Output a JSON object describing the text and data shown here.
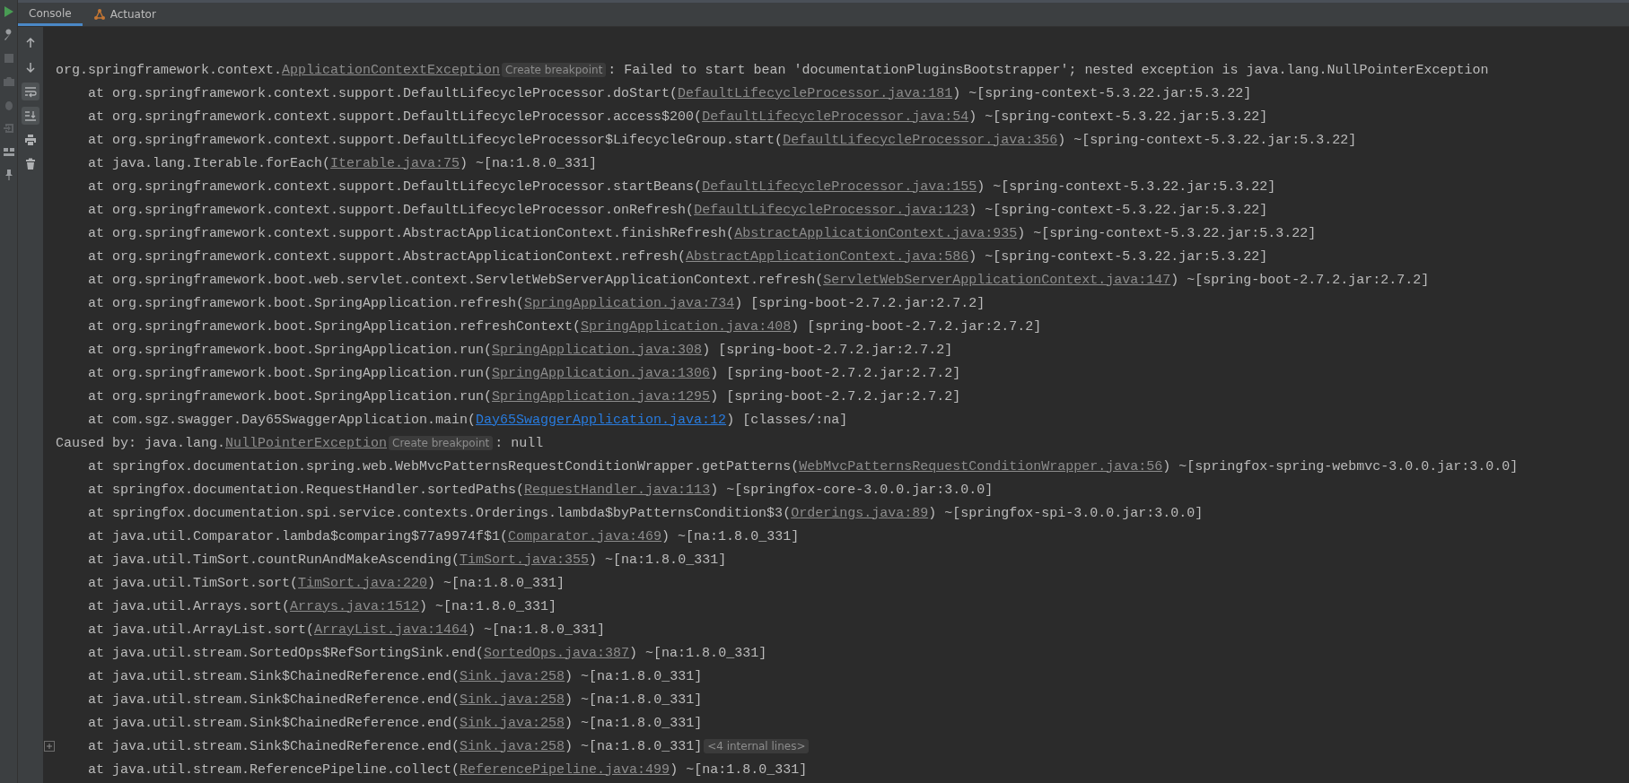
{
  "tabs": [
    {
      "label": "Console",
      "selected": true,
      "icon": false
    },
    {
      "label": "Actuator",
      "selected": false,
      "icon": true
    }
  ],
  "lines": [
    {
      "indent": false,
      "fold": false,
      "parts": [
        {
          "kind": "plain",
          "text": "org.springframework.context."
        },
        {
          "kind": "link",
          "text": "ApplicationContextException"
        },
        {
          "kind": "badge",
          "text": "Create breakpoint"
        },
        {
          "kind": "plain",
          "text": ": Failed to start bean 'documentationPluginsBootstrapper'; nested exception is java.lang.NullPointerException"
        }
      ]
    },
    {
      "indent": true,
      "fold": false,
      "parts": [
        {
          "kind": "plain",
          "text": "at org.springframework.context.support.DefaultLifecycleProcessor.doStart("
        },
        {
          "kind": "link",
          "text": "DefaultLifecycleProcessor.java:181"
        },
        {
          "kind": "plain",
          "text": ") ~[spring-context-5.3.22.jar:5.3.22]"
        }
      ]
    },
    {
      "indent": true,
      "fold": false,
      "parts": [
        {
          "kind": "plain",
          "text": "at org.springframework.context.support.DefaultLifecycleProcessor.access$200("
        },
        {
          "kind": "link",
          "text": "DefaultLifecycleProcessor.java:54"
        },
        {
          "kind": "plain",
          "text": ") ~[spring-context-5.3.22.jar:5.3.22]"
        }
      ]
    },
    {
      "indent": true,
      "fold": false,
      "parts": [
        {
          "kind": "plain",
          "text": "at org.springframework.context.support.DefaultLifecycleProcessor$LifecycleGroup.start("
        },
        {
          "kind": "link",
          "text": "DefaultLifecycleProcessor.java:356"
        },
        {
          "kind": "plain",
          "text": ") ~[spring-context-5.3.22.jar:5.3.22]"
        }
      ]
    },
    {
      "indent": true,
      "fold": false,
      "parts": [
        {
          "kind": "plain",
          "text": "at java.lang.Iterable.forEach("
        },
        {
          "kind": "link",
          "text": "Iterable.java:75"
        },
        {
          "kind": "plain",
          "text": ") ~[na:1.8.0_331]"
        }
      ]
    },
    {
      "indent": true,
      "fold": false,
      "parts": [
        {
          "kind": "plain",
          "text": "at org.springframework.context.support.DefaultLifecycleProcessor.startBeans("
        },
        {
          "kind": "link",
          "text": "DefaultLifecycleProcessor.java:155"
        },
        {
          "kind": "plain",
          "text": ") ~[spring-context-5.3.22.jar:5.3.22]"
        }
      ]
    },
    {
      "indent": true,
      "fold": false,
      "parts": [
        {
          "kind": "plain",
          "text": "at org.springframework.context.support.DefaultLifecycleProcessor.onRefresh("
        },
        {
          "kind": "link",
          "text": "DefaultLifecycleProcessor.java:123"
        },
        {
          "kind": "plain",
          "text": ") ~[spring-context-5.3.22.jar:5.3.22]"
        }
      ]
    },
    {
      "indent": true,
      "fold": false,
      "parts": [
        {
          "kind": "plain",
          "text": "at org.springframework.context.support.AbstractApplicationContext.finishRefresh("
        },
        {
          "kind": "link",
          "text": "AbstractApplicationContext.java:935"
        },
        {
          "kind": "plain",
          "text": ") ~[spring-context-5.3.22.jar:5.3.22]"
        }
      ]
    },
    {
      "indent": true,
      "fold": false,
      "parts": [
        {
          "kind": "plain",
          "text": "at org.springframework.context.support.AbstractApplicationContext.refresh("
        },
        {
          "kind": "link",
          "text": "AbstractApplicationContext.java:586"
        },
        {
          "kind": "plain",
          "text": ") ~[spring-context-5.3.22.jar:5.3.22]"
        }
      ]
    },
    {
      "indent": true,
      "fold": false,
      "parts": [
        {
          "kind": "plain",
          "text": "at org.springframework.boot.web.servlet.context.ServletWebServerApplicationContext.refresh("
        },
        {
          "kind": "link",
          "text": "ServletWebServerApplicationContext.java:147"
        },
        {
          "kind": "plain",
          "text": ") ~[spring-boot-2.7.2.jar:2.7.2]"
        }
      ]
    },
    {
      "indent": true,
      "fold": false,
      "parts": [
        {
          "kind": "plain",
          "text": "at org.springframework.boot.SpringApplication.refresh("
        },
        {
          "kind": "link",
          "text": "SpringApplication.java:734"
        },
        {
          "kind": "plain",
          "text": ") [spring-boot-2.7.2.jar:2.7.2]"
        }
      ]
    },
    {
      "indent": true,
      "fold": false,
      "parts": [
        {
          "kind": "plain",
          "text": "at org.springframework.boot.SpringApplication.refreshContext("
        },
        {
          "kind": "link",
          "text": "SpringApplication.java:408"
        },
        {
          "kind": "plain",
          "text": ") [spring-boot-2.7.2.jar:2.7.2]"
        }
      ]
    },
    {
      "indent": true,
      "fold": false,
      "parts": [
        {
          "kind": "plain",
          "text": "at org.springframework.boot.SpringApplication.run("
        },
        {
          "kind": "link",
          "text": "SpringApplication.java:308"
        },
        {
          "kind": "plain",
          "text": ") [spring-boot-2.7.2.jar:2.7.2]"
        }
      ]
    },
    {
      "indent": true,
      "fold": false,
      "parts": [
        {
          "kind": "plain",
          "text": "at org.springframework.boot.SpringApplication.run("
        },
        {
          "kind": "link",
          "text": "SpringApplication.java:1306"
        },
        {
          "kind": "plain",
          "text": ") [spring-boot-2.7.2.jar:2.7.2]"
        }
      ]
    },
    {
      "indent": true,
      "fold": false,
      "parts": [
        {
          "kind": "plain",
          "text": "at org.springframework.boot.SpringApplication.run("
        },
        {
          "kind": "link",
          "text": "SpringApplication.java:1295"
        },
        {
          "kind": "plain",
          "text": ") [spring-boot-2.7.2.jar:2.7.2]"
        }
      ]
    },
    {
      "indent": true,
      "fold": false,
      "parts": [
        {
          "kind": "plain",
          "text": "at com.sgz.swagger.Day65SwaggerApplication.main("
        },
        {
          "kind": "source_link",
          "text": "Day65SwaggerApplication.java:12"
        },
        {
          "kind": "plain",
          "text": ") [classes/:na]"
        }
      ]
    },
    {
      "indent": false,
      "fold": false,
      "parts": [
        {
          "kind": "plain",
          "text": "Caused by: java.lang."
        },
        {
          "kind": "link",
          "text": "NullPointerException"
        },
        {
          "kind": "badge",
          "text": "Create breakpoint"
        },
        {
          "kind": "plain",
          "text": ": null"
        }
      ]
    },
    {
      "indent": true,
      "fold": false,
      "parts": [
        {
          "kind": "plain",
          "text": "at springfox.documentation.spring.web.WebMvcPatternsRequestConditionWrapper.getPatterns("
        },
        {
          "kind": "link",
          "text": "WebMvcPatternsRequestConditionWrapper.java:56"
        },
        {
          "kind": "plain",
          "text": ") ~[springfox-spring-webmvc-3.0.0.jar:3.0.0]"
        }
      ]
    },
    {
      "indent": true,
      "fold": false,
      "parts": [
        {
          "kind": "plain",
          "text": "at springfox.documentation.RequestHandler.sortedPaths("
        },
        {
          "kind": "link",
          "text": "RequestHandler.java:113"
        },
        {
          "kind": "plain",
          "text": ") ~[springfox-core-3.0.0.jar:3.0.0]"
        }
      ]
    },
    {
      "indent": true,
      "fold": false,
      "parts": [
        {
          "kind": "plain",
          "text": "at springfox.documentation.spi.service.contexts.Orderings.lambda$byPatternsCondition$3("
        },
        {
          "kind": "link",
          "text": "Orderings.java:89"
        },
        {
          "kind": "plain",
          "text": ") ~[springfox-spi-3.0.0.jar:3.0.0]"
        }
      ]
    },
    {
      "indent": true,
      "fold": false,
      "parts": [
        {
          "kind": "plain",
          "text": "at java.util.Comparator.lambda$comparing$77a9974f$1("
        },
        {
          "kind": "link",
          "text": "Comparator.java:469"
        },
        {
          "kind": "plain",
          "text": ") ~[na:1.8.0_331]"
        }
      ]
    },
    {
      "indent": true,
      "fold": false,
      "parts": [
        {
          "kind": "plain",
          "text": "at java.util.TimSort.countRunAndMakeAscending("
        },
        {
          "kind": "link",
          "text": "TimSort.java:355"
        },
        {
          "kind": "plain",
          "text": ") ~[na:1.8.0_331]"
        }
      ]
    },
    {
      "indent": true,
      "fold": false,
      "parts": [
        {
          "kind": "plain",
          "text": "at java.util.TimSort.sort("
        },
        {
          "kind": "link",
          "text": "TimSort.java:220"
        },
        {
          "kind": "plain",
          "text": ") ~[na:1.8.0_331]"
        }
      ]
    },
    {
      "indent": true,
      "fold": false,
      "parts": [
        {
          "kind": "plain",
          "text": "at java.util.Arrays.sort("
        },
        {
          "kind": "link",
          "text": "Arrays.java:1512"
        },
        {
          "kind": "plain",
          "text": ") ~[na:1.8.0_331]"
        }
      ]
    },
    {
      "indent": true,
      "fold": false,
      "parts": [
        {
          "kind": "plain",
          "text": "at java.util.ArrayList.sort("
        },
        {
          "kind": "link",
          "text": "ArrayList.java:1464"
        },
        {
          "kind": "plain",
          "text": ") ~[na:1.8.0_331]"
        }
      ]
    },
    {
      "indent": true,
      "fold": false,
      "parts": [
        {
          "kind": "plain",
          "text": "at java.util.stream.SortedOps$RefSortingSink.end("
        },
        {
          "kind": "link",
          "text": "SortedOps.java:387"
        },
        {
          "kind": "plain",
          "text": ") ~[na:1.8.0_331]"
        }
      ]
    },
    {
      "indent": true,
      "fold": false,
      "parts": [
        {
          "kind": "plain",
          "text": "at java.util.stream.Sink$ChainedReference.end("
        },
        {
          "kind": "link",
          "text": "Sink.java:258"
        },
        {
          "kind": "plain",
          "text": ") ~[na:1.8.0_331]"
        }
      ]
    },
    {
      "indent": true,
      "fold": false,
      "parts": [
        {
          "kind": "plain",
          "text": "at java.util.stream.Sink$ChainedReference.end("
        },
        {
          "kind": "link",
          "text": "Sink.java:258"
        },
        {
          "kind": "plain",
          "text": ") ~[na:1.8.0_331]"
        }
      ]
    },
    {
      "indent": true,
      "fold": false,
      "parts": [
        {
          "kind": "plain",
          "text": "at java.util.stream.Sink$ChainedReference.end("
        },
        {
          "kind": "link",
          "text": "Sink.java:258"
        },
        {
          "kind": "plain",
          "text": ") ~[na:1.8.0_331]"
        }
      ]
    },
    {
      "indent": true,
      "fold": true,
      "parts": [
        {
          "kind": "plain",
          "text": "at java.util.stream.Sink$ChainedReference.end("
        },
        {
          "kind": "link",
          "text": "Sink.java:258"
        },
        {
          "kind": "plain",
          "text": ") ~[na:1.8.0_331]"
        },
        {
          "kind": "badge",
          "text": "<4 internal lines>"
        }
      ]
    },
    {
      "indent": true,
      "fold": false,
      "parts": [
        {
          "kind": "plain",
          "text": "at java.util.stream.ReferencePipeline.collect("
        },
        {
          "kind": "link",
          "text": "ReferencePipeline.java:499"
        },
        {
          "kind": "plain",
          "text": ") ~[na:1.8.0_331]"
        }
      ]
    }
  ],
  "toolbar": [
    {
      "kind": "up",
      "on": false
    },
    {
      "kind": "down",
      "on": false
    },
    {
      "kind": "wrap",
      "on": true
    },
    {
      "kind": "scroll",
      "on": true
    },
    {
      "kind": "print",
      "on": false
    },
    {
      "kind": "trash",
      "on": false
    }
  ]
}
